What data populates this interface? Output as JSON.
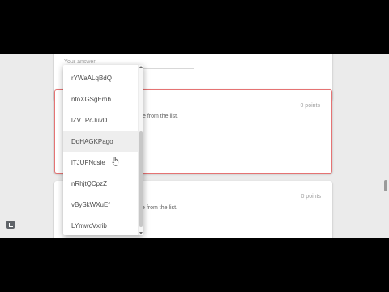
{
  "form": {
    "your_answer_placeholder": "Your answer",
    "question_2": {
      "points": "0 points",
      "instruction": "e from the list."
    },
    "question_3": {
      "points": "0 points",
      "instruction": "e from the list."
    }
  },
  "dropdown": {
    "options": [
      "rYWaALqBdQ",
      "nfoXGSgEmb",
      "lZVTPcJuvD",
      "DqHAGKPago",
      "lTJUFNdsie",
      "nRhjtQCpzZ",
      "vBySkWXuEf",
      "LYmwcVxrib"
    ],
    "selected_index": 3
  },
  "colors": {
    "error_border": "#e57373",
    "background": "#ebebeb",
    "letterbox": "#000000"
  }
}
